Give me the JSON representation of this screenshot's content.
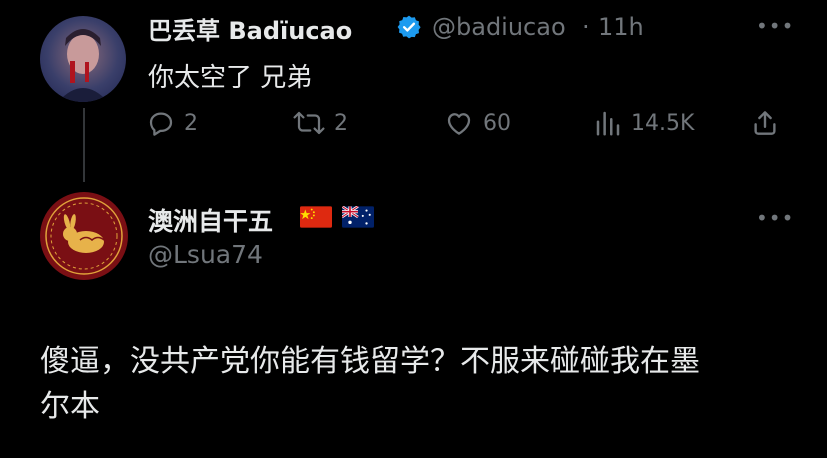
{
  "tweet1": {
    "display_name": "巴丢草 Badïucao",
    "handle": "@badiucao",
    "separator": "·",
    "time": "11h",
    "text": "你太空了 兄弟",
    "actions": {
      "replies": "2",
      "retweets": "2",
      "likes": "60",
      "views": "14.5K"
    },
    "icons": [
      "reply-icon",
      "retweet-icon",
      "like-icon",
      "views-icon",
      "share-icon"
    ]
  },
  "tweet2": {
    "display_name": "澳洲自干五",
    "handle": "@Lsua74",
    "text_line1": "傻逼，没共产党你能有钱留学？不服来碰碰我在墨",
    "text_line2": "尔本",
    "flags": [
      "china-flag-icon",
      "australia-flag-icon"
    ]
  },
  "colors": {
    "background": "#000000",
    "text": "#e7e9ea",
    "secondary": "#71767b",
    "verified": "#1d9bf0"
  }
}
